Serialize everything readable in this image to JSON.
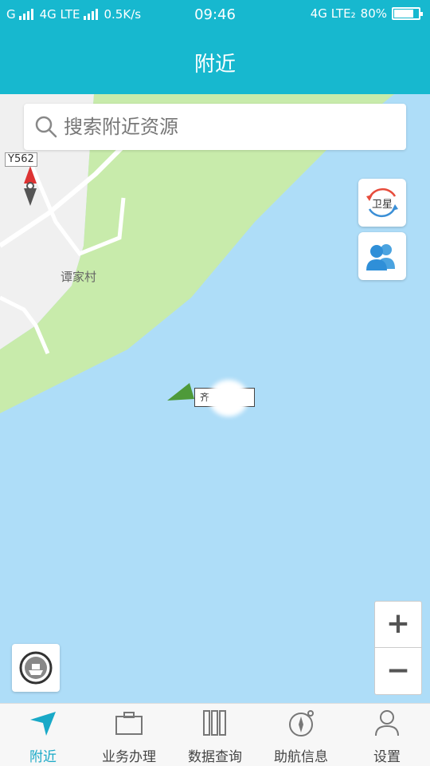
{
  "status_bar": {
    "carrier_left": "G",
    "network_left": "4G LTE",
    "speed": "0.5K/s",
    "time": "09:46",
    "network_right": "4G LTE₂",
    "battery": "80%",
    "battery_level": 0.8
  },
  "header": {
    "title": "附近"
  },
  "search": {
    "placeholder": "搜索附近资源",
    "value": ""
  },
  "map": {
    "road_label": "Y562",
    "village_label": "谭家村",
    "vessel_label": "齐",
    "satellite_button_label": "卫星",
    "zoom_in_label": "+",
    "zoom_out_label": "−"
  },
  "bottom_nav": {
    "items": [
      {
        "label": "附近",
        "icon": "navigation-arrow-icon",
        "active": true
      },
      {
        "label": "业务办理",
        "icon": "briefcase-icon",
        "active": false
      },
      {
        "label": "数据查询",
        "icon": "data-query-icon",
        "active": false
      },
      {
        "label": "助航信息",
        "icon": "compass-icon",
        "active": false
      },
      {
        "label": "设置",
        "icon": "user-settings-icon",
        "active": false
      }
    ]
  },
  "colors": {
    "accent": "#17b8cf",
    "water": "#aeddf8",
    "land_green": "#c8ebab",
    "vessel": "#4e9a3a",
    "nav_active": "#19a9c7"
  }
}
